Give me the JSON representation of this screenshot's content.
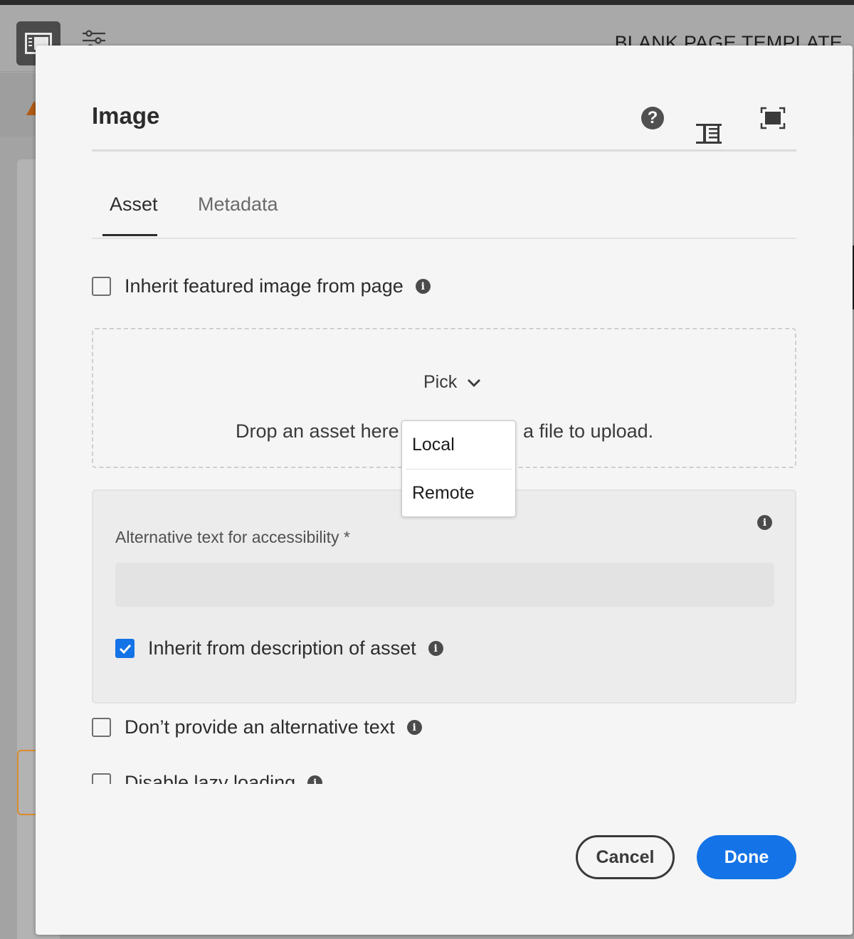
{
  "app": {
    "template_title": "BLANK PAGE TEMPLATE",
    "icons": {
      "panel_toggle": "panel-toggle-icon",
      "settings": "sliders-icon",
      "warning": "warning-icon"
    }
  },
  "dialog": {
    "title": "Image",
    "header_icons": [
      "help-icon",
      "resize-handle-icon",
      "fullscreen-icon"
    ],
    "tabs": [
      {
        "label": "Asset",
        "active": true
      },
      {
        "label": "Metadata",
        "active": false
      }
    ],
    "inherit_featured": {
      "label": "Inherit featured image from page",
      "checked": false
    },
    "dropzone": {
      "pick_label": "Pick",
      "text_before": "Drop an asset here",
      "text_after": "a file to upload."
    },
    "pick_menu": {
      "items": [
        "Local",
        "Remote"
      ]
    },
    "alt_text": {
      "label": "Alternative text for accessibility *",
      "value": "",
      "inherit": {
        "label": "Inherit from description of asset",
        "checked": true
      }
    },
    "no_alt": {
      "label": "Don’t provide an alternative text",
      "checked": false
    },
    "lazy": {
      "label": "Disable lazy loading",
      "checked": false
    },
    "buttons": {
      "cancel": "Cancel",
      "done": "Done"
    },
    "colors": {
      "accent": "#1473e6",
      "text": "#2c2c2c",
      "dialog_bg": "#f5f5f5",
      "panel_bg": "#ececec"
    }
  }
}
